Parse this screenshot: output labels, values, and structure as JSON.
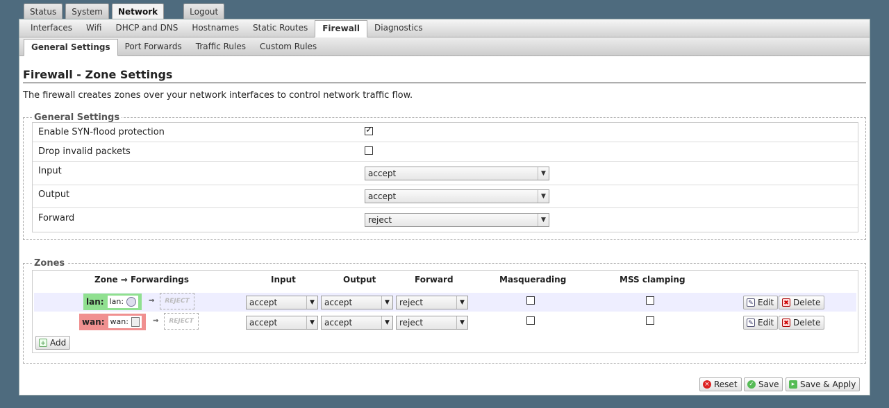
{
  "top_tabs": [
    "Status",
    "System",
    "Network",
    "Logout"
  ],
  "sub_tabs": [
    "Interfaces",
    "Wifi",
    "DHCP and DNS",
    "Hostnames",
    "Static Routes",
    "Firewall",
    "Diagnostics"
  ],
  "sub_sub_tabs": [
    "General Settings",
    "Port Forwards",
    "Traffic Rules",
    "Custom Rules"
  ],
  "page": {
    "title": "Firewall - Zone Settings",
    "description": "The firewall creates zones over your network interfaces to control network traffic flow."
  },
  "general": {
    "legend": "General Settings",
    "syn_label": "Enable SYN-flood protection",
    "syn_checked": true,
    "drop_label": "Drop invalid packets",
    "drop_checked": false,
    "input_label": "Input",
    "input_value": "accept",
    "output_label": "Output",
    "output_value": "accept",
    "forward_label": "Forward",
    "forward_value": "reject"
  },
  "zones": {
    "legend": "Zones",
    "headers": {
      "zone": "Zone ⇒ Forwardings",
      "input": "Input",
      "output": "Output",
      "forward": "Forward",
      "masq": "Masquerading",
      "mss": "MSS clamping"
    },
    "rows": [
      {
        "name": "lan:",
        "iface": "lan:",
        "target": "REJECT",
        "input": "accept",
        "output": "accept",
        "forward": "reject",
        "color": "#90e090"
      },
      {
        "name": "wan:",
        "iface": "wan:",
        "target": "REJECT",
        "input": "accept",
        "output": "accept",
        "forward": "reject",
        "color": "#f09090"
      }
    ],
    "edit_label": "Edit",
    "delete_label": "Delete",
    "add_label": "Add",
    "arrow": "⇒"
  },
  "actions": {
    "reset": "Reset",
    "save": "Save",
    "save_apply": "Save & Apply"
  }
}
